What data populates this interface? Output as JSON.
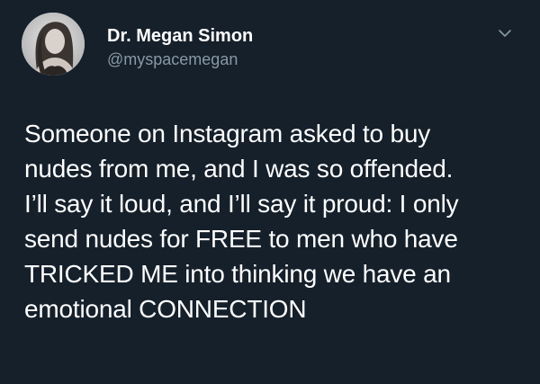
{
  "author": {
    "display_name": "Dr. Megan Simon",
    "handle": "@myspacemegan",
    "avatar_icon": "profile-photo"
  },
  "menu": {
    "icon": "chevron-down-icon"
  },
  "tweet": {
    "lines": [
      "Someone on Instagram asked to buy",
      "nudes from me, and I was so offended.",
      "I’ll say it loud, and I’ll say it proud: I only",
      "send nudes for FREE to men who have",
      "TRICKED ME into thinking we have an",
      "emotional CONNECTION"
    ]
  },
  "colors": {
    "background": "#15202b",
    "primary_text": "#ffffff",
    "secondary_text": "#8899a6"
  }
}
